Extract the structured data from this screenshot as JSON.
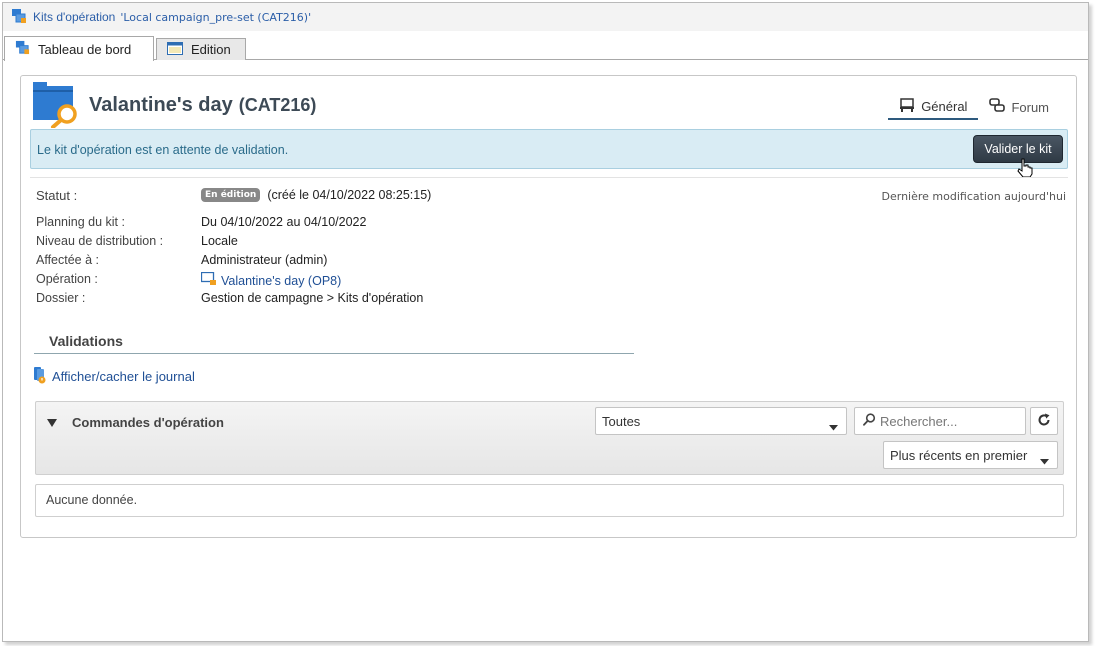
{
  "titlebar": {
    "title": "Kits d'opération",
    "subtitle": "'Local campaign_pre-set (CAT216)'"
  },
  "tabs": [
    {
      "label": "Tableau de bord",
      "active": true
    },
    {
      "label": "Edition",
      "active": false
    }
  ],
  "header": {
    "title": "Valantine's day",
    "code": "(CAT216)",
    "views": [
      {
        "label": "Général",
        "icon": "desk-icon",
        "active": true
      },
      {
        "label": "Forum",
        "icon": "chat-icon",
        "active": false
      }
    ]
  },
  "banner": {
    "message": "Le kit d'opération est en attente de validation.",
    "button_label": "Valider le kit"
  },
  "info": {
    "status_label": "Statut :",
    "status_badge": "En édition",
    "status_created": "(créé le 04/10/2022 08:25:15)",
    "last_modified": "Dernière modification aujourd'hui",
    "rows": [
      {
        "key": "Planning du kit :",
        "value": "Du 04/10/2022 au 04/10/2022"
      },
      {
        "key": "Niveau de distribution :",
        "value": "Locale"
      },
      {
        "key": "Affectée à :",
        "value": "Administrateur (admin)"
      },
      {
        "key": "Opération :",
        "value": "Valantine's day (OP8)"
      },
      {
        "key": "Dossier :",
        "value": "Gestion de campagne > Kits d'opération"
      }
    ]
  },
  "validations": {
    "section_title": "Validations",
    "journal_link": "Afficher/cacher le journal"
  },
  "commands": {
    "title": "Commandes d'opération",
    "filter_value": "Toutes",
    "search_placeholder": "Rechercher...",
    "sort_value": "Plus récents en premier",
    "empty_text": "Aucune donnée."
  },
  "colors": {
    "accent": "#2b5ea8",
    "banner_bg": "#d9ecf4",
    "button_bg": "#3a4551",
    "folder_blue": "#2e7bd1",
    "magnifier_orange": "#f0a020"
  }
}
